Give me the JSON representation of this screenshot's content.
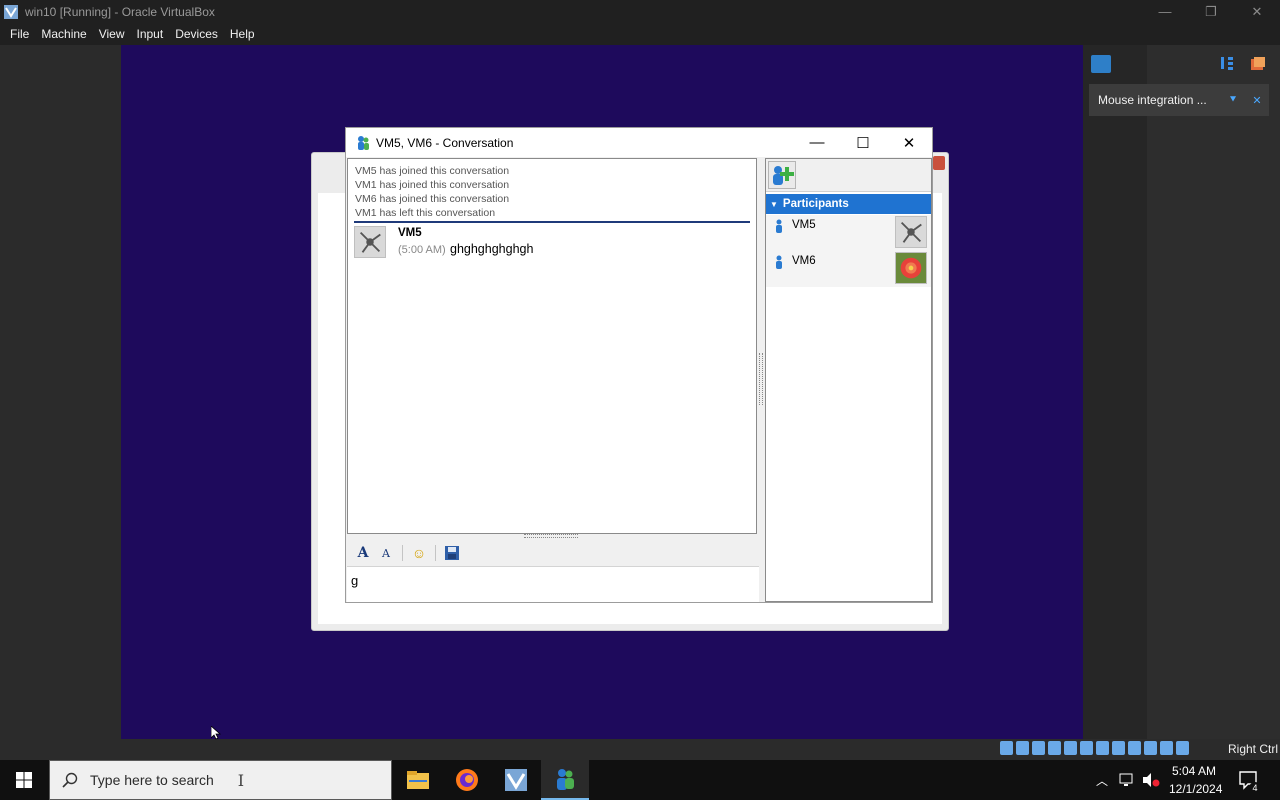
{
  "host": {
    "title": "win10 [Running] - Oracle VirtualBox",
    "menu": [
      "File",
      "Machine",
      "View",
      "Input",
      "Devices",
      "Help"
    ],
    "window_controls": {
      "minimize": "—",
      "restore": "❐",
      "close": "✕"
    },
    "notification": {
      "text": "Mouse integration ...",
      "pin": "⯆",
      "close": "✕"
    },
    "host_key": "Right Ctrl"
  },
  "conversation": {
    "title": "VM5, VM6 - Conversation",
    "controls": {
      "minimize": "—",
      "maximize": "☐",
      "close": "✕"
    },
    "system_messages": [
      "VM5 has joined this conversation",
      "VM1 has joined this conversation",
      "VM6 has joined this conversation",
      "VM1 has left this conversation"
    ],
    "message": {
      "author": "VM5",
      "time": "(5:00 AM)",
      "text": "ghghghghghgh"
    },
    "format_bar": {
      "font": "A",
      "color": "A",
      "emoticon": "☺",
      "save": "💾"
    },
    "compose_text": "g",
    "participants_header": "Participants",
    "participants": [
      {
        "name": "VM5",
        "avatar": "network-icon"
      },
      {
        "name": "VM6",
        "avatar": "flower-photo"
      }
    ]
  },
  "taskbar": {
    "search_placeholder": "Type here to search",
    "apps": [
      "file-explorer",
      "firefox",
      "virtualbox",
      "windows-messenger"
    ],
    "time": "5:04 AM",
    "date": "12/1/2024",
    "notification_count": "4"
  },
  "colors": {
    "guest_bg": "#1e0a5c",
    "participants_header": "#1f73d1",
    "accent": "#76b9ed"
  }
}
